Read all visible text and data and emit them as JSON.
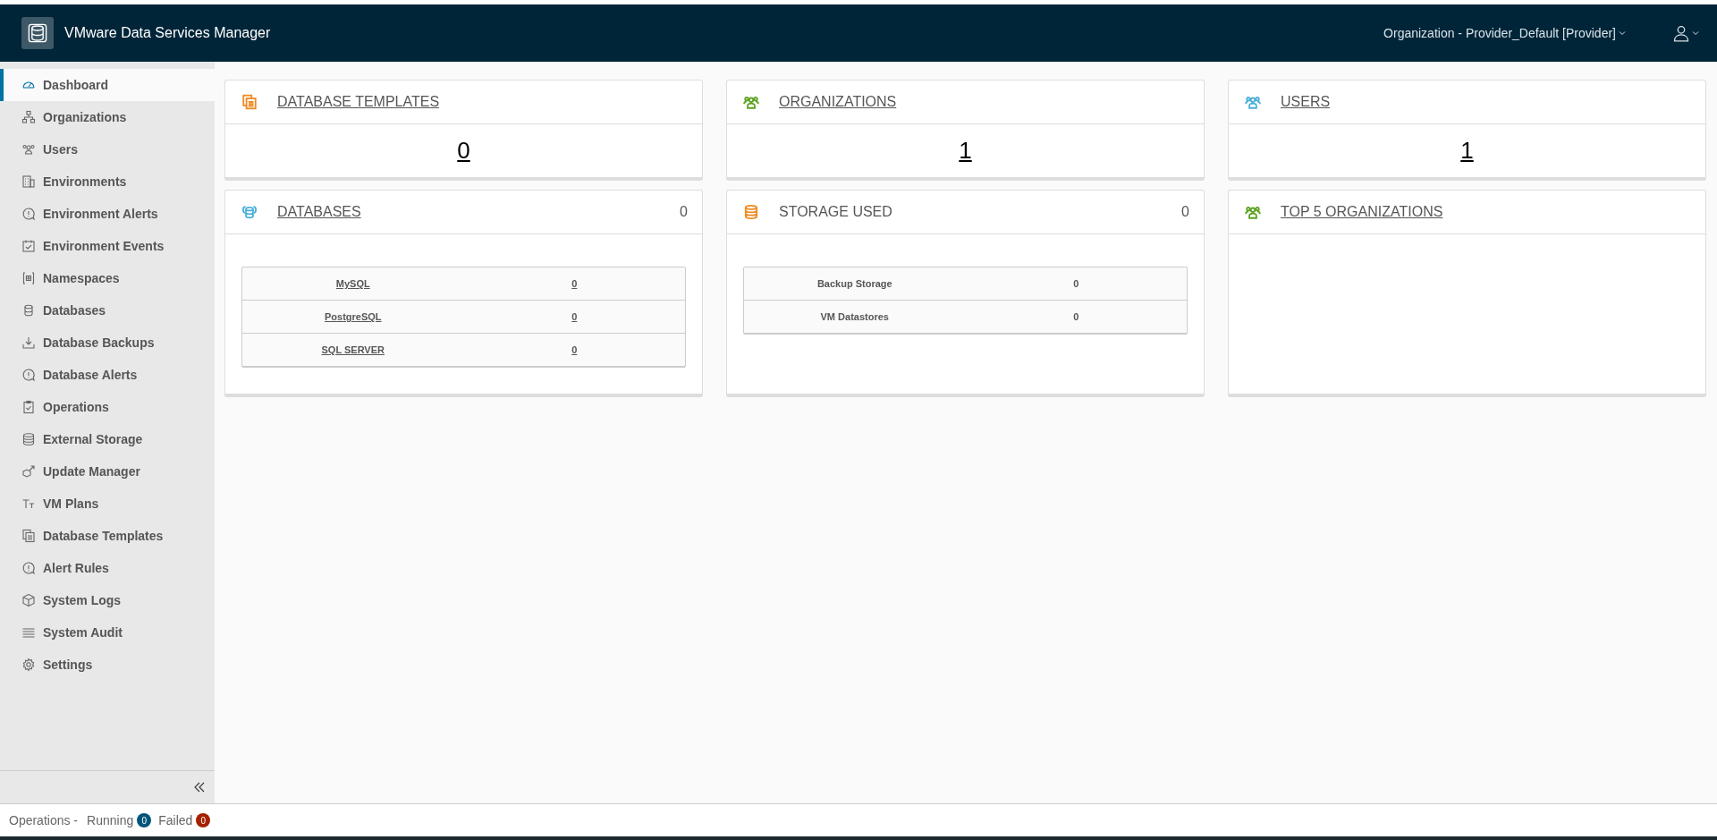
{
  "header": {
    "title": "VMware Data Services Manager",
    "org_menu": "Organization - Provider_Default [Provider]"
  },
  "sidebar": {
    "items": [
      {
        "label": "Dashboard",
        "selected": true
      },
      {
        "label": "Organizations",
        "selected": false
      },
      {
        "label": "Users",
        "selected": false
      },
      {
        "label": "Environments",
        "selected": false
      },
      {
        "label": "Environment Alerts",
        "selected": false
      },
      {
        "label": "Environment Events",
        "selected": false
      },
      {
        "label": "Namespaces",
        "selected": false
      },
      {
        "label": "Databases",
        "selected": false
      },
      {
        "label": "Database Backups",
        "selected": false
      },
      {
        "label": "Database Alerts",
        "selected": false
      },
      {
        "label": "Operations",
        "selected": false
      },
      {
        "label": "External Storage",
        "selected": false
      },
      {
        "label": "Update Manager",
        "selected": false
      },
      {
        "label": "VM Plans",
        "selected": false
      },
      {
        "label": "Database Templates",
        "selected": false
      },
      {
        "label": "Alert Rules",
        "selected": false
      },
      {
        "label": "System Logs",
        "selected": false
      },
      {
        "label": "System Audit",
        "selected": false
      },
      {
        "label": "Settings",
        "selected": false
      }
    ]
  },
  "cards": [
    {
      "kind": "count",
      "title": "DATABASE TEMPLATES",
      "link": true,
      "color": "#f08a24",
      "value": "0"
    },
    {
      "kind": "count",
      "title": "ORGANIZATIONS",
      "link": true,
      "color": "#5aa220",
      "value": "1"
    },
    {
      "kind": "count",
      "title": "USERS",
      "link": true,
      "color": "#49afd9",
      "value": "1"
    },
    {
      "kind": "table",
      "title": "DATABASES",
      "link": true,
      "color": "#49afd9",
      "count": "0",
      "rows_link": true,
      "rows": [
        {
          "name": "MySQL",
          "value": "0"
        },
        {
          "name": "PostgreSQL",
          "value": "0"
        },
        {
          "name": "SQL SERVER",
          "value": "0"
        }
      ]
    },
    {
      "kind": "table",
      "title": "STORAGE USED",
      "link": false,
      "color": "#f08a24",
      "count": "0",
      "rows_link": false,
      "rows": [
        {
          "name": "Backup Storage",
          "value": "0"
        },
        {
          "name": "VM Datastores",
          "value": "0"
        }
      ]
    },
    {
      "kind": "empty",
      "title": "TOP 5 ORGANIZATIONS",
      "link": true,
      "color": "#5aa220"
    }
  ],
  "status_bar": {
    "label": "Operations -",
    "counters": [
      {
        "label": "Running",
        "value": "0",
        "color": "#00567a"
      },
      {
        "label": "Failed",
        "value": "0",
        "color": "#a32100"
      }
    ]
  }
}
